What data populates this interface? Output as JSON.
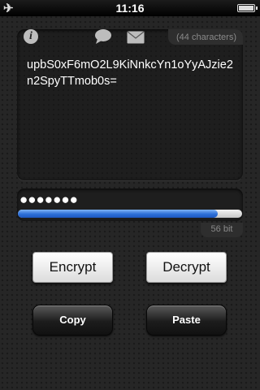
{
  "status_bar": {
    "time": "11:16",
    "airplane_icon": "airplane-icon",
    "battery_icon": "battery-icon"
  },
  "toolbar": {
    "info_icon": "info-icon",
    "info_glyph": "i",
    "sms_icon": "chat-bubble-icon",
    "email_icon": "envelope-icon"
  },
  "text_panel": {
    "char_count": "(44 characters)",
    "text": "upbS0xF6mO2L9KiNnkcYn1oYyAJzie2n2SpyTTmob0s="
  },
  "password": {
    "masked_value": "●●●●●●●",
    "strength_fraction": 0.89,
    "strength_label": "56 bit",
    "accent_color": "#2d6fd8"
  },
  "buttons": {
    "encrypt": "Encrypt",
    "decrypt": "Decrypt",
    "copy": "Copy",
    "paste": "Paste"
  }
}
